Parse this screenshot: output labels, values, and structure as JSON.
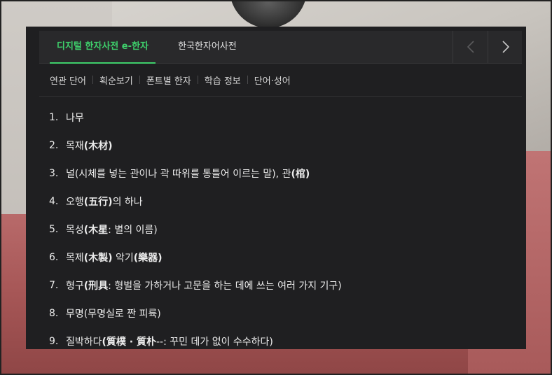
{
  "tabs": [
    {
      "label": "디지털 한자사전 e-한자",
      "active": true
    },
    {
      "label": "한국한자어사전",
      "active": false
    }
  ],
  "nav": {
    "prev_icon": "chevron-left-icon",
    "next_icon": "chevron-right-icon"
  },
  "subnav": [
    "연관 단어",
    "획순보기",
    "폰트별 한자",
    "학습 정보",
    "단어·성어"
  ],
  "definitions": [
    {
      "num": "1.",
      "parts": [
        {
          "t": "나무"
        }
      ]
    },
    {
      "num": "2.",
      "parts": [
        {
          "t": "목재"
        },
        {
          "t": "(木材)",
          "b": true
        }
      ]
    },
    {
      "num": "3.",
      "parts": [
        {
          "t": "널(시체를 넣는 관이나 곽 따위를 통틀어 이르는 말), 관"
        },
        {
          "t": "(棺)",
          "b": true
        }
      ]
    },
    {
      "num": "4.",
      "parts": [
        {
          "t": "오행"
        },
        {
          "t": "(五行)",
          "b": true
        },
        {
          "t": "의 하나"
        }
      ]
    },
    {
      "num": "5.",
      "parts": [
        {
          "t": "목성"
        },
        {
          "t": "(木星",
          "b": true
        },
        {
          "t": ": 별의 이름)"
        }
      ]
    },
    {
      "num": "6.",
      "parts": [
        {
          "t": "목제"
        },
        {
          "t": "(木製)",
          "b": true
        },
        {
          "t": " 악기"
        },
        {
          "t": "(樂器)",
          "b": true
        }
      ]
    },
    {
      "num": "7.",
      "parts": [
        {
          "t": "형구"
        },
        {
          "t": "(刑具",
          "b": true
        },
        {
          "t": ": 형벌을 가하거나 고문을 하는 데에 쓰는 여러 가지 기구)"
        }
      ]
    },
    {
      "num": "8.",
      "parts": [
        {
          "t": "무명(무명실로 짠 피륙)"
        }
      ]
    },
    {
      "num": "9.",
      "parts": [
        {
          "t": "질박하다"
        },
        {
          "t": "(質樸 · 質朴",
          "b": true
        },
        {
          "t": "--: 꾸민 데가 없이 수수하다)"
        }
      ]
    }
  ],
  "colors": {
    "accent": "#3ecf6b",
    "panel": "#1f1f21",
    "tabbar": "#29292b"
  }
}
